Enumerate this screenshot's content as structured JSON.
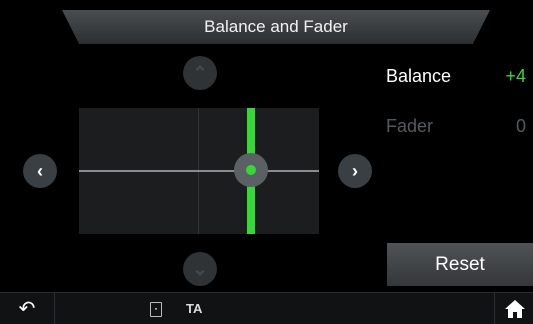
{
  "header": {
    "title": "Balance and Fader"
  },
  "controls": {
    "up_icon": "chevron-up-icon",
    "down_icon": "chevron-down-icon",
    "left_icon": "chevron-left-icon",
    "right_icon": "chevron-right-icon"
  },
  "settings": {
    "balance": {
      "label": "Balance",
      "value": "+4"
    },
    "fader": {
      "label": "Fader",
      "value": "0"
    }
  },
  "reset_label": "Reset",
  "status": {
    "ta_label": "TA"
  },
  "colors": {
    "accent_green": "#38d638",
    "inactive_text": "#555a5e"
  }
}
